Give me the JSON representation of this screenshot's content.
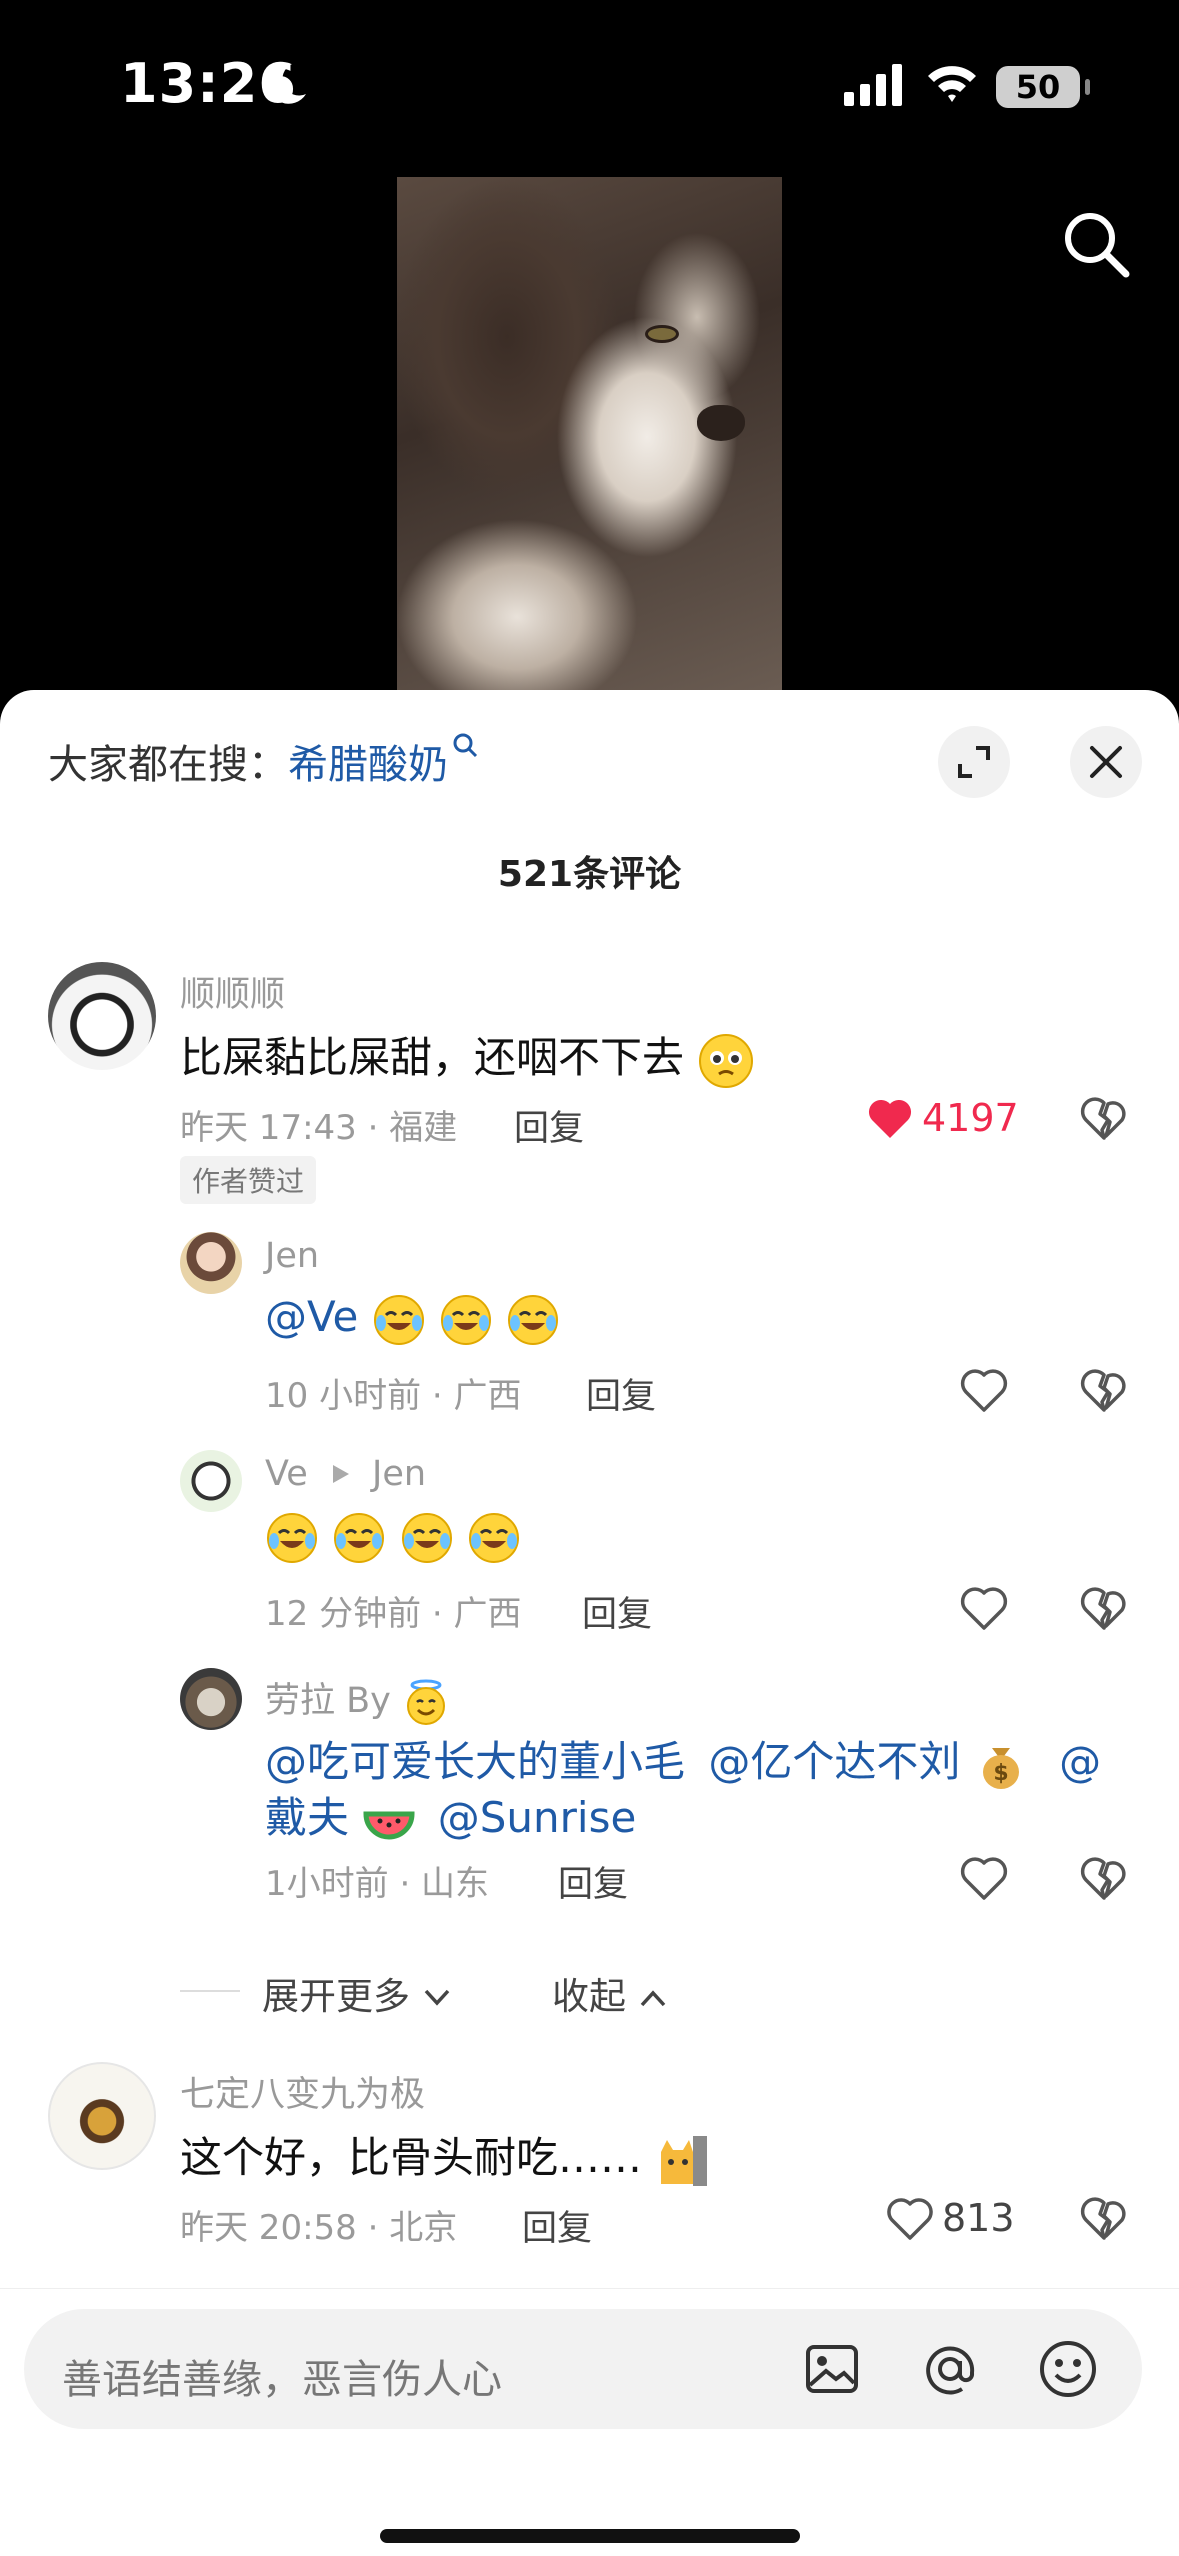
{
  "status_bar": {
    "time": "13:26",
    "battery": "50"
  },
  "hot_search": {
    "prefix": "大家都在搜：",
    "keyword": "希腊酸奶"
  },
  "comment_count": "521条评论",
  "comments": [
    {
      "username": "顺顺顺",
      "text": "比屎黏比屎甜，还咽不下去",
      "time_location": "昨天 17:43 · 福建",
      "reply_label": "回复",
      "likes": "4197",
      "liked": true,
      "author_tag": "作者赞过"
    },
    {
      "username": "Jen",
      "mention": "@Ve",
      "time_location": "10 小时前 · 广西",
      "reply_label": "回复"
    },
    {
      "username": "Ve",
      "reply_to": "Jen",
      "time_location": "12 分钟前 · 广西",
      "reply_label": "回复"
    },
    {
      "username": "劳拉 By",
      "mention1": "@吃可爱长大的董小毛",
      "mention2": "@亿个达不刘",
      "mention3_at": "@",
      "mention3_name": "戴夫",
      "mention4": "@Sunrise",
      "time_location": "1小时前 · 山东",
      "reply_label": "回复"
    },
    {
      "username": "七定八变九为极",
      "text": "这个好，比骨头耐吃……",
      "time_location": "昨天 20:58 · 北京",
      "reply_label": "回复",
      "likes": "813"
    }
  ],
  "expand_more": "展开更多",
  "collapse": "收起",
  "input": {
    "placeholder": "善语结善缘，恶言伤人心"
  },
  "colors": {
    "like_red": "#f0294e",
    "mention_blue": "#1f5aa6"
  }
}
